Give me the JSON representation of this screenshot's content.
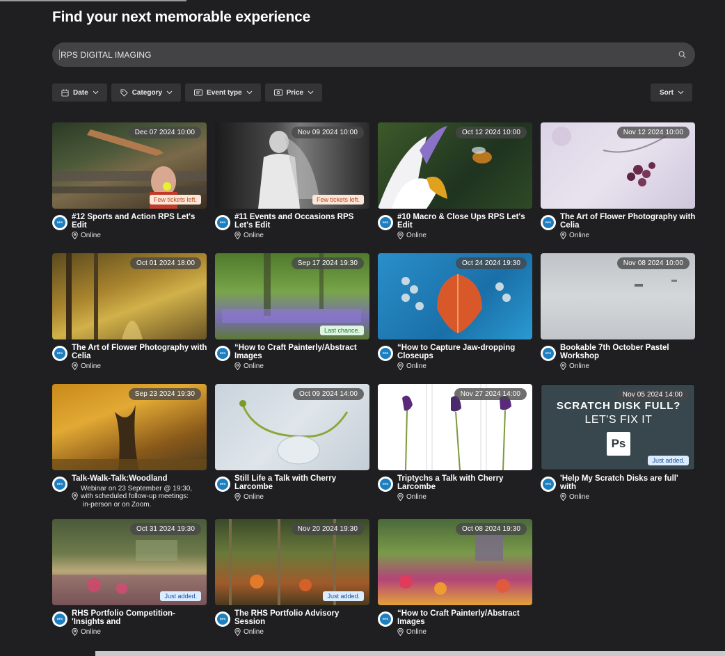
{
  "page": {
    "title": "Find your next memorable experience"
  },
  "search": {
    "value": "RPS DIGITAL IMAGING"
  },
  "filters": [
    {
      "label": "Date",
      "icon": "calendar-icon"
    },
    {
      "label": "Category",
      "icon": "tag-icon"
    },
    {
      "label": "Event type",
      "icon": "ticket-icon"
    },
    {
      "label": "Price",
      "icon": "price-icon"
    }
  ],
  "sort": {
    "label": "Sort"
  },
  "colors": {
    "background": "#1f1f21",
    "search_bg": "#434346",
    "button_bg": "#343437"
  },
  "events": [
    {
      "date": "Dec 07 2024 10:00",
      "title": "#12 Sports and Action RPS Let's Edit",
      "location": "Online",
      "badge": "Few tickets left.",
      "badge_type": "warn"
    },
    {
      "date": "Nov 09 2024 10:00",
      "title": "#11 Events and Occasions RPS Let's Edit",
      "location": "Online",
      "badge": "Few tickets left.",
      "badge_type": "warn"
    },
    {
      "date": "Oct 12 2024 10:00",
      "title": "#10 Macro & Close Ups RPS Let's Edit",
      "location": "Online"
    },
    {
      "date": "Nov 12 2024 10:00",
      "title": "The Art of Flower Photography with Celia",
      "location": "Online"
    },
    {
      "date": "Oct 01 2024 18:00",
      "title": "The Art of Flower Photography with Celia",
      "location": "Online"
    },
    {
      "date": "Sep 17 2024 19:30",
      "title": "“How to Craft Painterly/Abstract Images",
      "location": "Online",
      "badge": "Last chance.",
      "badge_type": "last"
    },
    {
      "date": "Oct 24 2024 19:30",
      "title": "“How to Capture Jaw-dropping Closeups",
      "location": "Online"
    },
    {
      "date": "Nov 08 2024 10:00",
      "title": "Bookable 7th October Pastel Workshop",
      "location": "Online"
    },
    {
      "date": "Sep 23 2024 19:30",
      "title": "Talk-Walk-Talk:Woodland",
      "location": "Webinar on 23 September @ 19:30,",
      "location_extra": "with scheduled follow-up meetings:",
      "location_extra2": "in-person or on Zoom."
    },
    {
      "date": "Oct 09 2024 14:00",
      "title": "Still Life a Talk with Cherry Larcombe",
      "location": "Online"
    },
    {
      "date": "Nov 27 2024 14:00",
      "title": "Triptychs a Talk with Cherry Larcombe",
      "location": "Online"
    },
    {
      "date": "Nov 05 2024 14:00",
      "title": "'Help My Scratch Disks are full' with",
      "location": "Online",
      "badge": "Just added.",
      "badge_type": "new",
      "thumb_text1": "SCRATCH DISK FULL?",
      "thumb_text2": "LET'S FIX IT",
      "thumb_text3": "Ps"
    },
    {
      "date": "Oct 31 2024 19:30",
      "title": "RHS Portfolio Competition- 'Insights and",
      "location": "Online",
      "badge": "Just added.",
      "badge_type": "new"
    },
    {
      "date": "Nov 20 2024 19:30",
      "title": "The RHS Portfolio Advisory Session",
      "location": "Online",
      "badge": "Just added.",
      "badge_type": "new"
    },
    {
      "date": "Oct 08 2024 19:30",
      "title": "“How to Craft Painterly/Abstract Images",
      "location": "Online"
    }
  ]
}
